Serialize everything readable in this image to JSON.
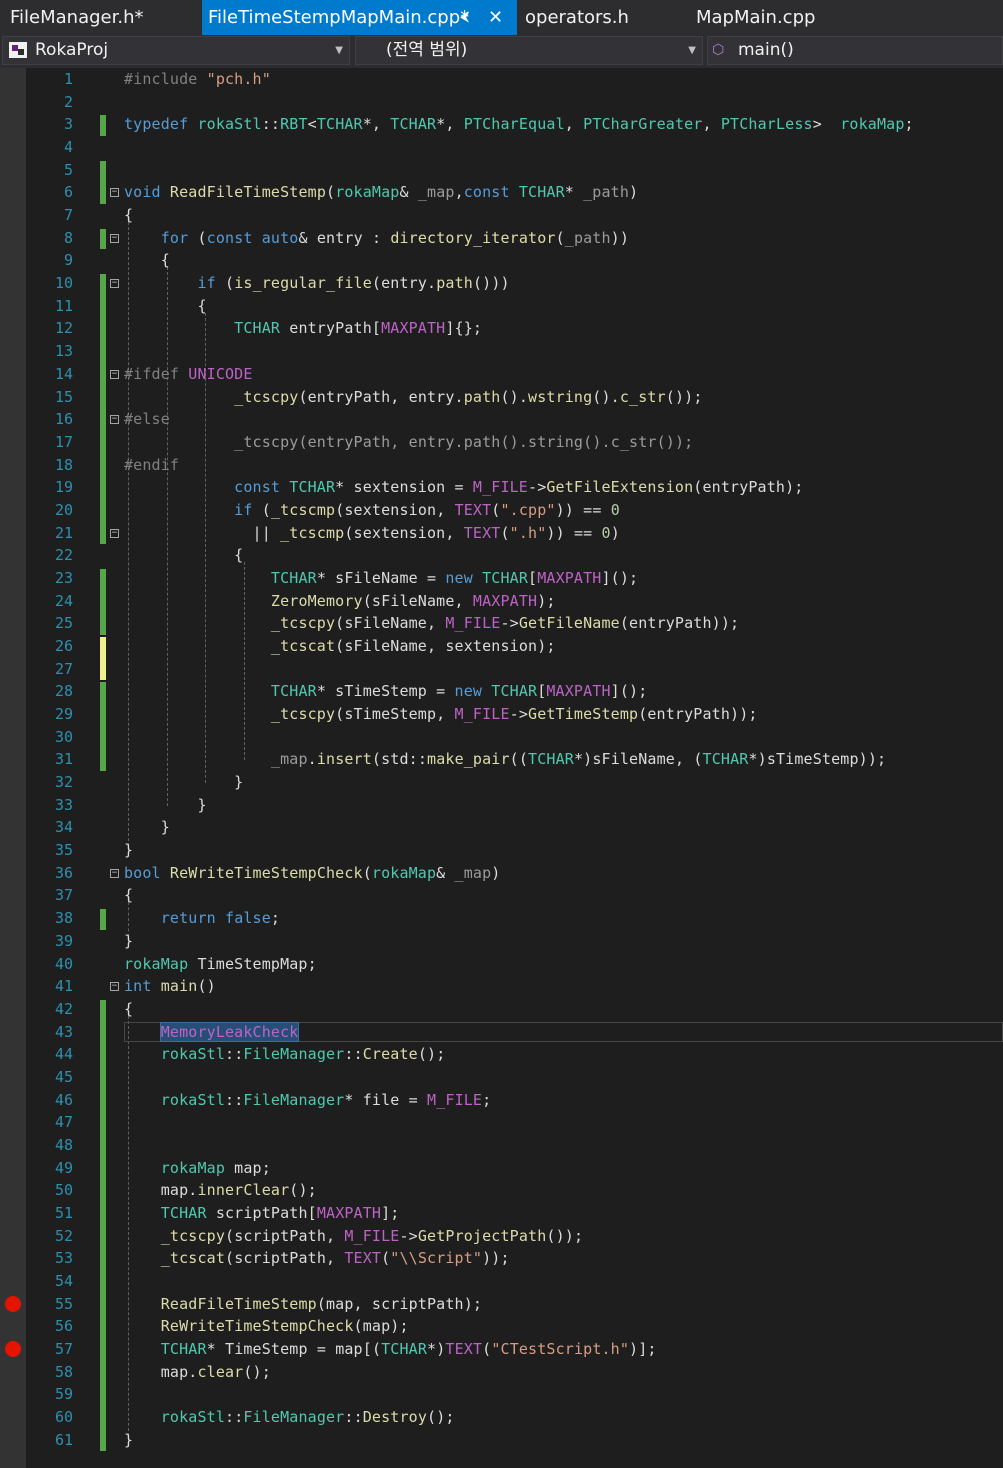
{
  "tabs": [
    {
      "label": "FileManager.h*",
      "active": false
    },
    {
      "label": "FileTimeStempMapMain.cpp*",
      "active": true
    },
    {
      "label": "operators.h",
      "active": false
    },
    {
      "label": "MapMain.cpp",
      "active": false
    }
  ],
  "navigation": {
    "project": "RokaProj",
    "scope": "(전역 범위)",
    "member": "main()"
  },
  "colors": {
    "accent": "#007acc",
    "background": "#1e1e1e",
    "line_number": "#2b91af",
    "change_saved": "#57a64a",
    "change_unsaved": "#efef8f",
    "breakpoint": "#e51400"
  },
  "editor": {
    "current_line": 43,
    "selected_text": "MemoryLeakCheck",
    "breakpoints": [
      55,
      57
    ],
    "fold_markers": [
      6,
      8,
      10,
      14,
      16,
      21,
      36,
      41
    ],
    "lines": [
      "#include \"pch.h\"",
      "",
      "typedef rokaStl::RBT<TCHAR*, TCHAR*, PTCharEqual, PTCharGreater, PTCharLess>  rokaMap;",
      "",
      "",
      "void ReadFileTimeStemp(rokaMap& _map,const TCHAR* _path)",
      "{",
      "    for (const auto& entry : directory_iterator(_path))",
      "    {",
      "        if (is_regular_file(entry.path()))",
      "        {",
      "            TCHAR entryPath[MAXPATH]{};",
      "",
      "#ifdef UNICODE",
      "            _tcscpy(entryPath, entry.path().wstring().c_str());",
      "#else",
      "            _tcscpy(entryPath, entry.path().string().c_str());",
      "#endif",
      "            const TCHAR* sextension = M_FILE->GetFileExtension(entryPath);",
      "            if (_tcscmp(sextension, TEXT(\".cpp\")) == 0",
      "              || _tcscmp(sextension, TEXT(\".h\")) == 0)",
      "            {",
      "                TCHAR* sFileName = new TCHAR[MAXPATH]();",
      "                ZeroMemory(sFileName, MAXPATH);",
      "                _tcscpy(sFileName, M_FILE->GetFileName(entryPath));",
      "                _tcscat(sFileName, sextension);",
      "",
      "                TCHAR* sTimeStemp = new TCHAR[MAXPATH]();",
      "                _tcscpy(sTimeStemp, M_FILE->GetTimeStemp(entryPath));",
      "",
      "                _map.insert(std::make_pair((TCHAR*)sFileName, (TCHAR*)sTimeStemp));",
      "            }",
      "        }",
      "    }",
      "}",
      "bool ReWriteTimeStempCheck(rokaMap& _map)",
      "{",
      "    return false;",
      "}",
      "rokaMap TimeStempMap;",
      "int main()",
      "{",
      "    MemoryLeakCheck",
      "    rokaStl::FileManager::Create();",
      "",
      "    rokaStl::FileManager* file = M_FILE;",
      "",
      "",
      "    rokaMap map;",
      "    map.innerClear();",
      "    TCHAR scriptPath[MAXPATH];",
      "    _tcscpy(scriptPath, M_FILE->GetProjectPath());",
      "    _tcscat(scriptPath, TEXT(\"\\\\Script\"));",
      "",
      "    ReadFileTimeStemp(map, scriptPath);",
      "    ReWriteTimeStempCheck(map);",
      "    TCHAR* TimeStemp = map[(TCHAR*)TEXT(\"CTestScript.h\")];",
      "    map.clear();",
      "",
      "    rokaStl::FileManager::Destroy();",
      "}"
    ]
  }
}
